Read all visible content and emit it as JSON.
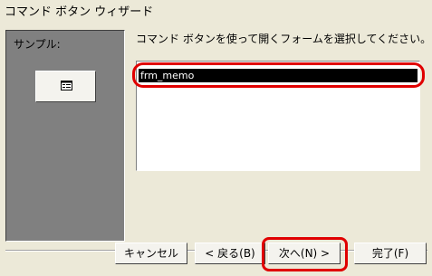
{
  "window": {
    "title": "コマンド ボタン ウィザード"
  },
  "sample": {
    "label": "サンプル:",
    "icon": "form-icon"
  },
  "instruction": "コマンド ボタンを使って開くフォームを選択してください。",
  "forms": {
    "items": [
      "frm_memo"
    ],
    "selected": "frm_memo"
  },
  "buttons": {
    "cancel": "キャンセル",
    "back": "< 戻る(B)",
    "next": "次へ(N) >",
    "finish": "完了(F)"
  },
  "colors": {
    "highlight": "#e00000",
    "selection": "#000000",
    "panel": "#808080"
  }
}
